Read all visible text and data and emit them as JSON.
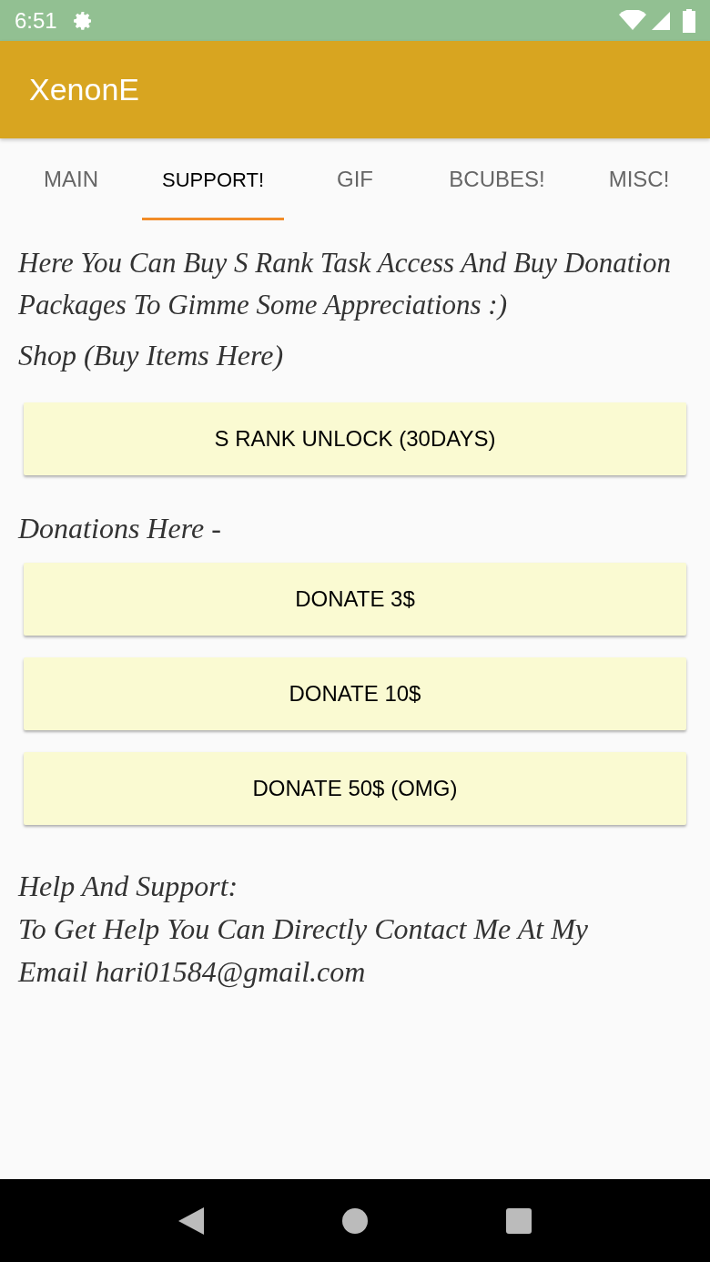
{
  "status_bar": {
    "time": "6:51"
  },
  "app_bar": {
    "title": "XenonE"
  },
  "tabs": [
    {
      "label": "MAIN",
      "selected": false
    },
    {
      "label": "SUPPORT!",
      "selected": true
    },
    {
      "label": "GIF",
      "selected": false
    },
    {
      "label": "BCUBES!",
      "selected": false
    },
    {
      "label": "MISC!",
      "selected": false
    }
  ],
  "intro": "Here You Can Buy S Rank Task Access And Buy Donation Packages To Gimme Some Appreciations :)",
  "shop_heading": "Shop (Buy Items Here)",
  "shop_buttons": [
    "S RANK UNLOCK (30DAYS)"
  ],
  "donations_heading": "Donations Here -",
  "donation_buttons": [
    "DONATE 3$",
    "DONATE 10$",
    "DONATE 50$ (OMG)"
  ],
  "help": {
    "title": "Help And Support:",
    "text": "To Get Help You Can Directly Contact Me At My Email hari01584@gmail.com"
  }
}
